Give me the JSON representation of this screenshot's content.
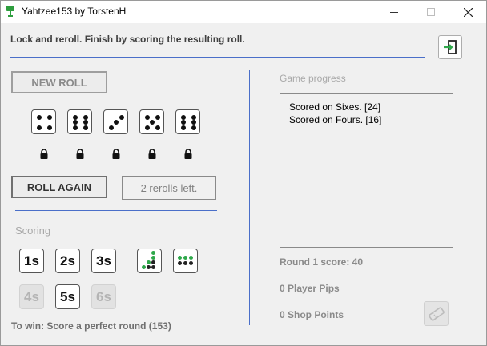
{
  "window": {
    "title": "Yahtzee153 by TorstenH"
  },
  "instruction": "Lock and reroll. Finish by scoring the resulting roll.",
  "buttons": {
    "new_roll": "NEW ROLL",
    "roll_again": "ROLL AGAIN"
  },
  "dice": [
    {
      "value": 4,
      "locked": true
    },
    {
      "value": 6,
      "locked": true
    },
    {
      "value": 3,
      "locked": true
    },
    {
      "value": 5,
      "locked": true
    },
    {
      "value": 6,
      "locked": true
    }
  ],
  "rerolls_text": "2 rerolls left.",
  "scoring": {
    "label": "Scoring",
    "row1": [
      {
        "label": "1s",
        "enabled": true
      },
      {
        "label": "2s",
        "enabled": true
      },
      {
        "label": "3s",
        "enabled": true
      }
    ],
    "row2": [
      {
        "label": "4s",
        "enabled": false
      },
      {
        "label": "5s",
        "enabled": true
      },
      {
        "label": "6s",
        "enabled": false
      }
    ],
    "special_icons": [
      "staircase-pips-icon",
      "grid-pips-icon"
    ]
  },
  "win_goal": "To win: Score a perfect round (153)",
  "progress": {
    "label": "Game progress",
    "entries": [
      "Scored on Sixes. [24]",
      "Scored on Fours. [16]"
    ]
  },
  "round_score": "Round 1 score: 40",
  "player_pips": "0 Player Pips",
  "shop_points": "0 Shop Points",
  "colors": {
    "accent_line": "#4a6fc9",
    "green_pip": "#2ea84a",
    "dark_pip": "#222222"
  }
}
